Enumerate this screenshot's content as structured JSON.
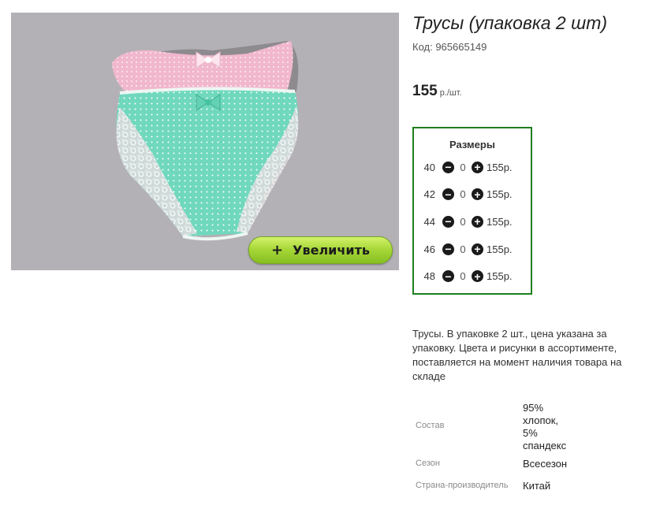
{
  "product": {
    "title": "Трусы (упаковка 2 шт)",
    "code": "Код: 965665149",
    "price": "155",
    "price_unit": "р./шт.",
    "zoom_button": {
      "icon": "plus-icon",
      "label": "Увеличить"
    }
  },
  "sizes": {
    "header": "Размеры",
    "rows": [
      {
        "size": "40",
        "qty": "0",
        "price": "155р."
      },
      {
        "size": "42",
        "qty": "0",
        "price": "155р."
      },
      {
        "size": "44",
        "qty": "0",
        "price": "155р."
      },
      {
        "size": "46",
        "qty": "0",
        "price": "155р."
      },
      {
        "size": "48",
        "qty": "0",
        "price": "155р."
      }
    ]
  },
  "description": "Трусы. В упаковке 2 шт., цена указана за упаковку. Цвета и рисунки в ассортименте, поставляется на момент наличия товара на складе",
  "attributes": [
    {
      "label": "Состав",
      "value_lines": [
        "95%",
        "хлопок,",
        "5%",
        "спандекс"
      ]
    },
    {
      "label": "Сезон",
      "value_lines": [
        "Всесезон"
      ]
    },
    {
      "label": "Страна-производитель",
      "value_lines": [
        "Китай"
      ]
    }
  ],
  "colors": {
    "frame_border": "#1e7e1e",
    "button_green": "#a8d83a",
    "photo_background": "#b3b1b6",
    "briefs_pink": "#f1b7cc",
    "briefs_mint": "#6fd8bd"
  }
}
